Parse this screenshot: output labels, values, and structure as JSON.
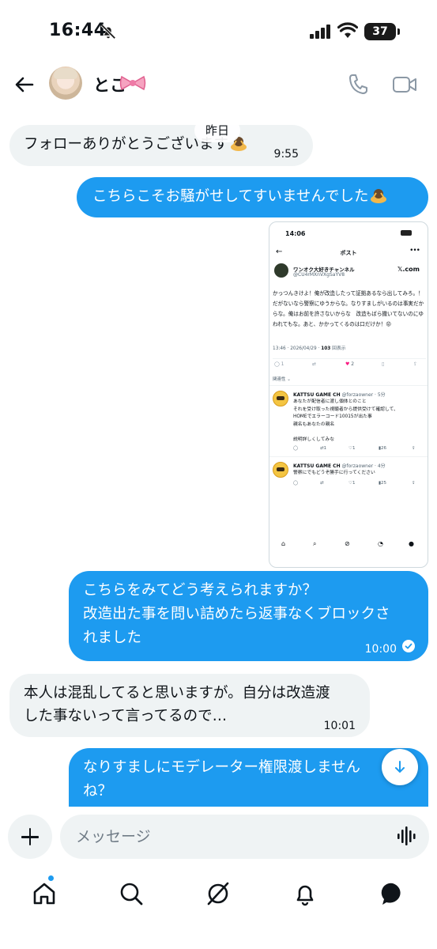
{
  "status_bar": {
    "time": "16:44",
    "battery": "37"
  },
  "header": {
    "contact_name": "とこ",
    "back": "back",
    "call": "phone",
    "video": "video"
  },
  "date_separator": "昨日",
  "messages": [
    {
      "direction": "in",
      "text": "フォローありがとうございます",
      "time": "9:55"
    },
    {
      "direction": "out",
      "text": "こちらこそお騒がせしてすいませんでした"
    },
    {
      "direction": "out",
      "text_lines": [
        "こちらをみてどう考えられますか？",
        "改造出た事を問い詰めたら返事なくブロックさ",
        "れました"
      ],
      "time": "10:00",
      "read": true
    },
    {
      "direction": "in",
      "text_lines": [
        "本人は混乱してると思いますが。自分は改造渡",
        "した事ないって言ってるので…"
      ],
      "time": "10:01"
    },
    {
      "direction": "out",
      "text_lines": [
        "なりすましにモデレーター権限渡しません",
        "ね？"
      ]
    }
  ],
  "attachment": {
    "status_time": "14:06",
    "title": "ポスト",
    "author_name": "ワンオク大好きチャンネル",
    "author_handle": "@CU4rMXnVXgSaYV8",
    "source": "𝕏.com",
    "body": "かっつんきけよ！俺が改造したって証拠あるなら出してみろ。！だがないなら警察にゆうからな。なりすましがいるのは事実だからな。俺はお前を許さないからな　改造もばら撒いてないのにゆわれてもな。あと、かかってくるのは口だけか！😡",
    "meta_prefix": "13:46 · 2026/04/29 · ",
    "views_count": "103",
    "views_label": "回表示",
    "reply_count": "1",
    "like_count": "2",
    "related_label": "関連性 ⌄",
    "replies": [
      {
        "name": "KATTSU GAME CH",
        "handle": "@forzaowner · 5分",
        "lines": [
          "あなたが配信者に渡し個体とのこと",
          "それを受け取った視聴者から提供受けて確認して、",
          "HOMEでエラーコード10015が出た事",
          "親名もあなたの親名",
          "",
          "説明詳しくしてみな"
        ],
        "retweets": "1",
        "likes": "1",
        "views": "26"
      },
      {
        "name": "KATTSU GAME CH",
        "handle": "@forzaowner · 4分",
        "lines": [
          "警察にでもどうぞ勝手に行ってください"
        ],
        "retweets": "",
        "likes": "1",
        "views": "25"
      }
    ]
  },
  "composer": {
    "placeholder": "メッセージ"
  },
  "bottom_nav": [
    "home",
    "search",
    "grok",
    "notifications",
    "messages"
  ],
  "colors": {
    "accent": "#1d9bf0",
    "incoming_bubble": "#eff3f4",
    "text": "#0f1419"
  }
}
